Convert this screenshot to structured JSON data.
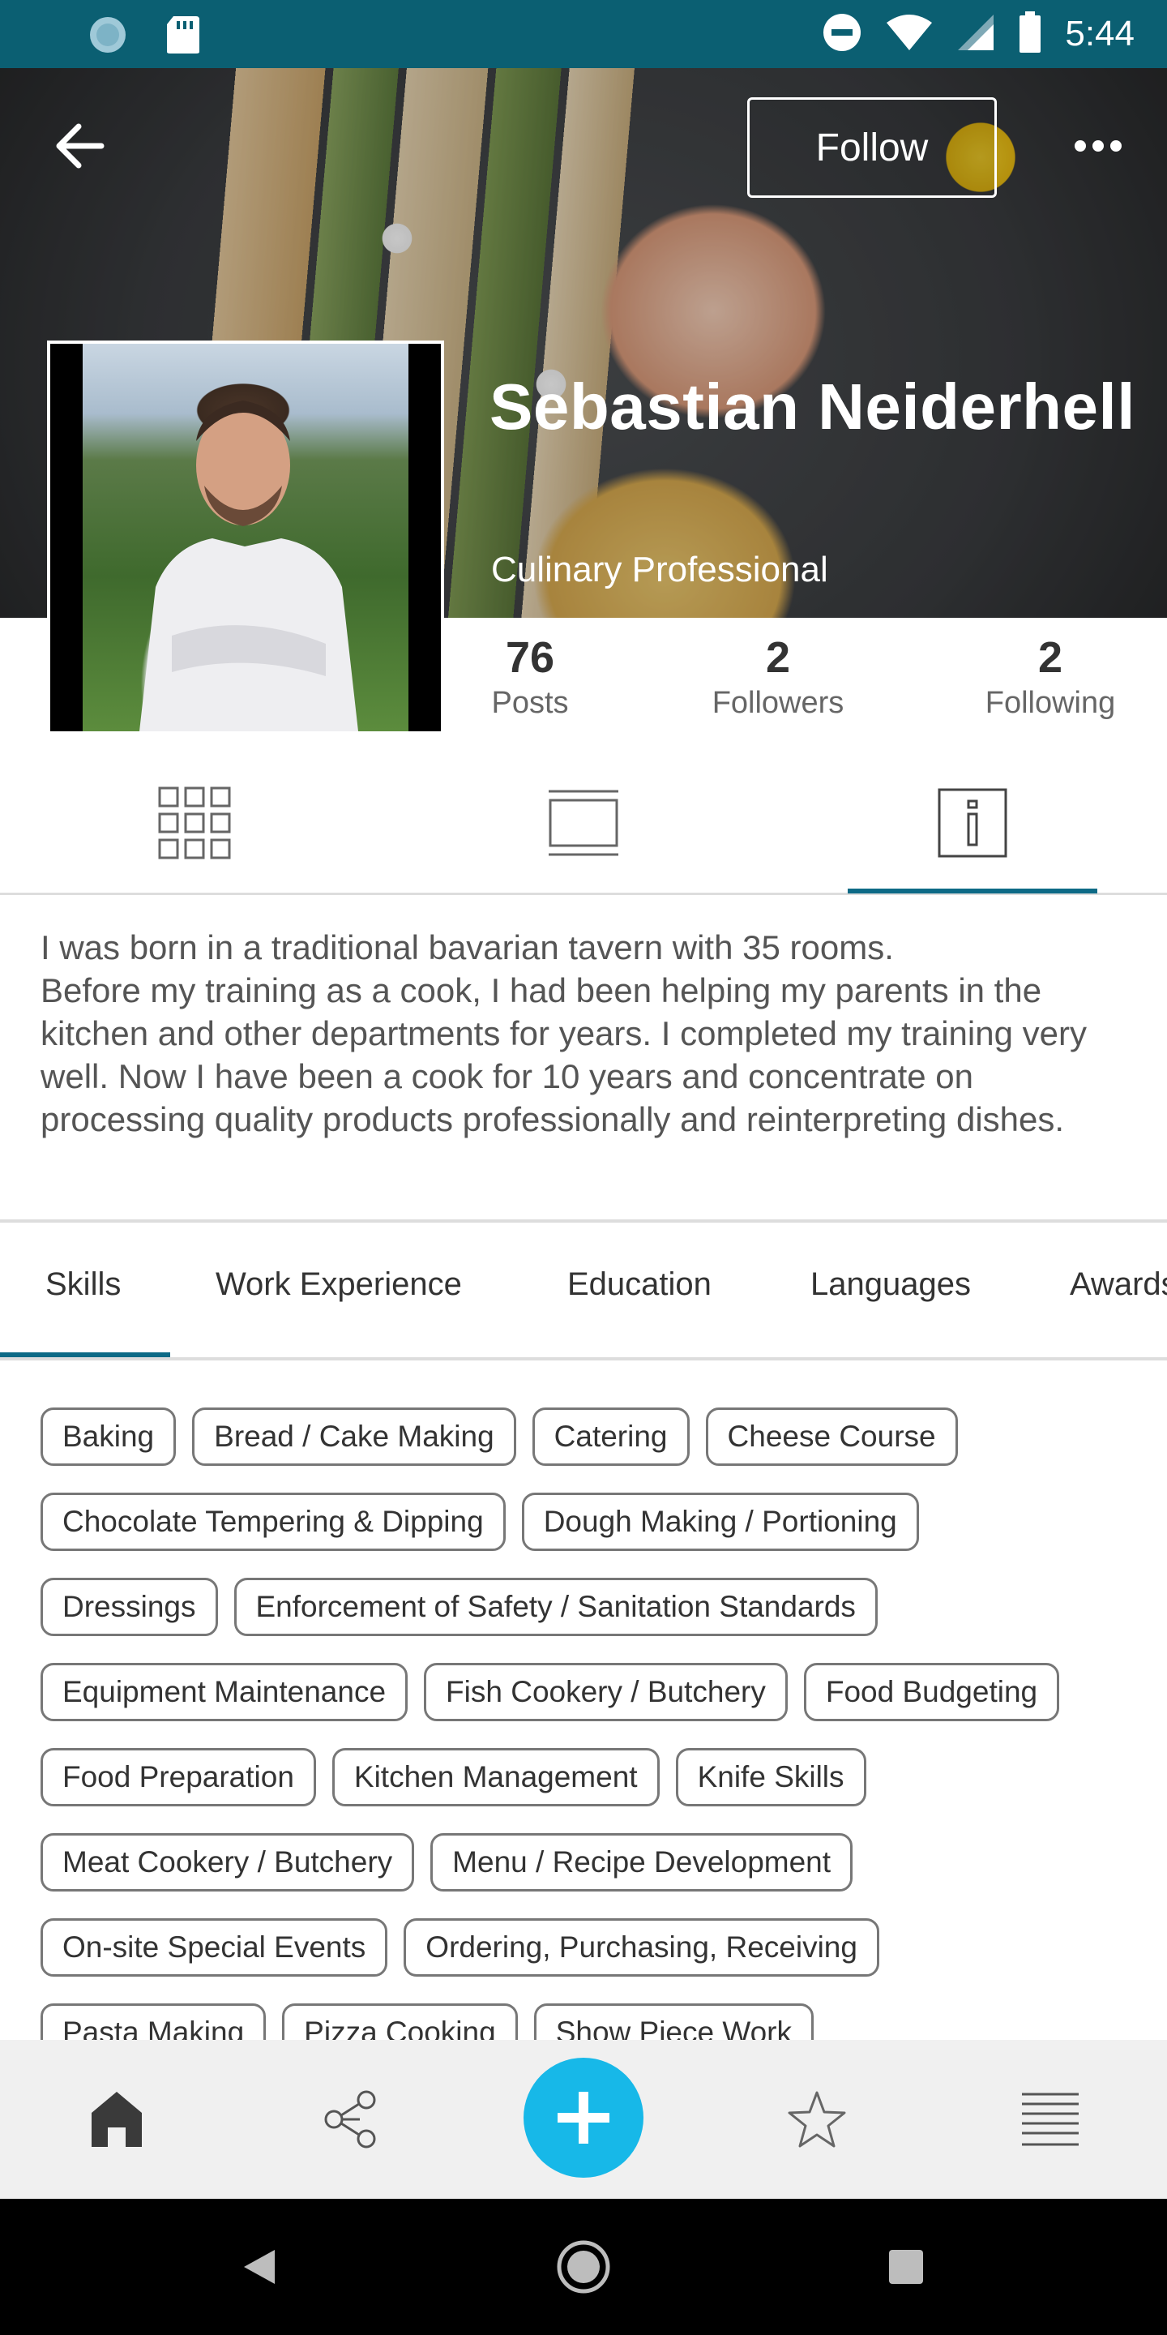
{
  "status_bar": {
    "time": "5:44",
    "icons_left": [
      "data-saver-icon",
      "sd-card-icon"
    ],
    "icons_right": [
      "do-not-disturb-icon",
      "wifi-icon",
      "signal-icon",
      "battery-icon"
    ]
  },
  "header": {
    "follow_label": "Follow",
    "name": "Sebastian Neiderhell",
    "role": "Culinary Professional"
  },
  "stats": [
    {
      "value": "76",
      "label": "Posts"
    },
    {
      "value": "2",
      "label": "Followers"
    },
    {
      "value": "2",
      "label": "Following"
    }
  ],
  "view_tabs": [
    "grid-view-icon",
    "list-view-icon",
    "info-icon"
  ],
  "bio": "I was born in a traditional bavarian tavern with 35 rooms.\nBefore my training as a cook, I had been helping my parents in the kitchen and other departments for years. I completed my training very well. Now I have been a cook for 10 years and concentrate on processing quality products professionally and reinterpreting dishes.",
  "section_tabs": [
    "Skills",
    "Work Experience",
    "Education",
    "Languages",
    "Awards"
  ],
  "skills": {
    "row0": [
      "Baking",
      "Bread / Cake Making",
      "Catering",
      "Cheese Course"
    ],
    "row1": [
      "Chocolate Tempering & Dipping",
      "Dough Making / Portioning"
    ],
    "row2": [
      "Dressings",
      "Enforcement of Safety / Sanitation Standards"
    ],
    "row3": [
      "Equipment Maintenance",
      "Fish Cookery / Butchery",
      "Food Budgeting"
    ],
    "row4": [
      "Food Preparation",
      "Kitchen Management",
      "Knife Skills"
    ],
    "row5": [
      "Meat Cookery / Butchery",
      "Menu / Recipe Development"
    ],
    "row6": [
      "On-site Special Events",
      "Ordering, Purchasing, Receiving"
    ],
    "row7": [
      "Pasta Making",
      "Pizza Cooking",
      "Show Piece Work"
    ]
  },
  "bottom_nav": [
    "home-icon",
    "network-icon",
    "add-icon",
    "star-icon",
    "menu-icon"
  ],
  "colors": {
    "status_bar": "#0b5f72",
    "accent": "#0d6a86",
    "fab": "#17b8e8"
  }
}
